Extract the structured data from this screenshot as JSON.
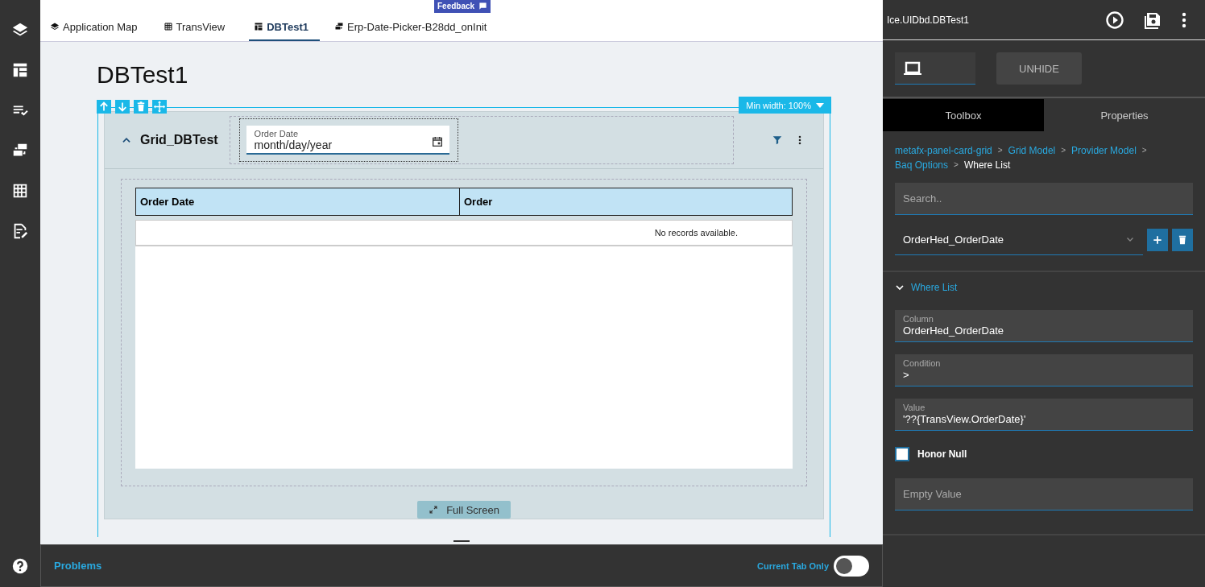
{
  "feedback": {
    "label": "Feedback"
  },
  "tabs": [
    {
      "label": "Application Map",
      "kind": "layers",
      "selected": false
    },
    {
      "label": "TransView",
      "kind": "grid",
      "selected": false
    },
    {
      "label": "DBTest1",
      "kind": "layout",
      "selected": true
    },
    {
      "label": "Erp-Date-Picker-B28dd_onInit",
      "kind": "flow",
      "selected": false
    }
  ],
  "page": {
    "title": "DBTest1"
  },
  "panel": {
    "min_width": "Min width: 100%",
    "title": "Grid_DBTest",
    "expanded": true,
    "date_field": {
      "label": "Order Date",
      "placeholder": "month/day/year"
    },
    "table": {
      "columns": [
        "Order Date",
        "Order"
      ],
      "empty_message": "No records available."
    },
    "full_screen": "Full Screen"
  },
  "problems": {
    "title": "Problems",
    "toggle_label": "Current Tab Only",
    "toggle_on": false
  },
  "inspector": {
    "title": "Ice.UIDbd.DBTest1",
    "unhide": "UNHIDE",
    "tabs": [
      {
        "label": "Toolbox",
        "selected": true
      },
      {
        "label": "Properties",
        "selected": false
      }
    ],
    "breadcrumb": [
      {
        "label": "metafx-panel-card-grid",
        "kind": "link"
      },
      {
        "separator": ">",
        "label": "Grid Model",
        "kind": "link"
      },
      {
        "separator": ">",
        "label": "Provider Model",
        "kind": "link"
      },
      {
        "separator": ">",
        "label": "Baq Options",
        "kind": "link"
      },
      {
        "separator": ">",
        "label": "Where List",
        "kind": "current"
      }
    ],
    "search": {
      "placeholder": "Search.."
    },
    "select": {
      "value": "OrderHed_OrderDate"
    },
    "section": {
      "title": "Where List",
      "expanded": true
    },
    "fields": [
      {
        "label": "Column",
        "value": "OrderHed_OrderDate"
      },
      {
        "label": "Condition",
        "value": ">"
      },
      {
        "label": "Value",
        "value": "'??{TransView.OrderDate}'"
      }
    ],
    "honor_null": {
      "label": "Honor Null",
      "checked": false
    },
    "empty_value": {
      "placeholder": "Empty Value"
    }
  }
}
